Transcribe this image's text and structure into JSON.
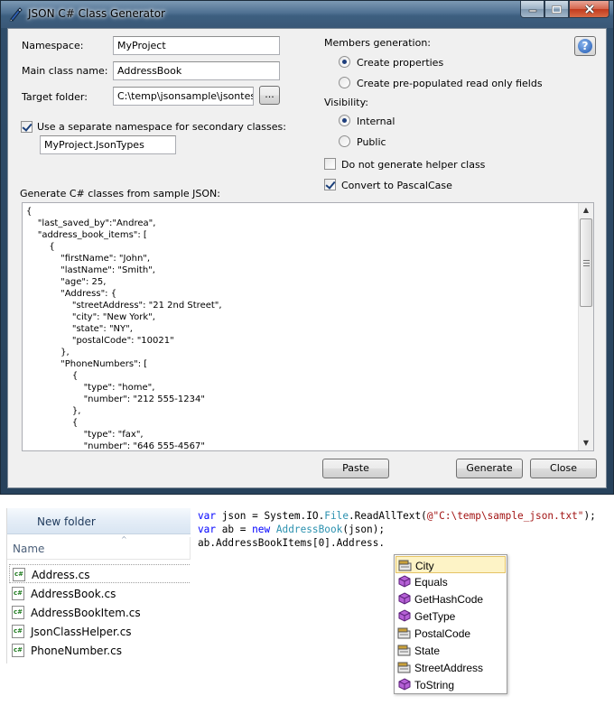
{
  "window": {
    "title": "JSON C# Class Generator"
  },
  "form": {
    "namespace_label": "Namespace:",
    "namespace_value": "MyProject",
    "main_class_label": "Main class name:",
    "main_class_value": "AddressBook",
    "target_folder_label": "Target folder:",
    "target_folder_value": "C:\\temp\\jsonsample\\jsontest\\",
    "browse_label": "...",
    "separate_ns_label": "Use a separate namespace for secondary classes:",
    "separate_ns_checked": true,
    "secondary_ns_value": "MyProject.JsonTypes",
    "sample_json_label": "Generate C# classes from sample JSON:"
  },
  "options": {
    "members_label": "Members generation:",
    "create_properties_label": "Create properties",
    "create_readonly_label": "Create pre-populated read only fields",
    "members_selected": "properties",
    "visibility_label": "Visibility:",
    "internal_label": "Internal",
    "public_label": "Public",
    "visibility_selected": "internal",
    "no_helper_label": "Do not generate helper class",
    "no_helper_checked": false,
    "pascal_label": "Convert to PascalCase",
    "pascal_checked": true
  },
  "json_sample": "{\n    \"last_saved_by\":\"Andrea\",\n    \"address_book_items\": [\n        {\n            \"firstName\": \"John\",\n            \"lastName\": \"Smith\",\n            \"age\": 25,\n            \"Address\": {\n                \"streetAddress\": \"21 2nd Street\",\n                \"city\": \"New York\",\n                \"state\": \"NY\",\n                \"postalCode\": \"10021\"\n            },\n            \"PhoneNumbers\": [\n                {\n                    \"type\": \"home\",\n                    \"number\": \"212 555-1234\"\n                },\n                {\n                    \"type\": \"fax\",\n                    \"number\": \"646 555-4567\"",
  "buttons": {
    "paste": "Paste",
    "generate": "Generate",
    "close": "Close"
  },
  "explorer": {
    "new_folder": "New folder",
    "column_name": "Name",
    "files": [
      "Address.cs",
      "AddressBook.cs",
      "AddressBookItem.cs",
      "JsonClassHelper.cs",
      "PhoneNumber.cs"
    ]
  },
  "code": {
    "line1": {
      "kw": "var",
      "a": " json = System.IO.",
      "type": "File",
      "b": ".ReadAllText(",
      "str": "@\"C:\\temp\\sample_json.txt\"",
      "c": ");"
    },
    "line2": {
      "kw1": "var",
      "a": " ab = ",
      "kw2": "new",
      "b": " ",
      "type": "AddressBook",
      "c": "(json);"
    },
    "line3": "ab.AddressBookItems[0].Address."
  },
  "intellisense": {
    "selected": "City",
    "items": [
      {
        "label": "City",
        "icon": "property-icon"
      },
      {
        "label": "Equals",
        "icon": "method-icon"
      },
      {
        "label": "GetHashCode",
        "icon": "method-icon"
      },
      {
        "label": "GetType",
        "icon": "method-icon"
      },
      {
        "label": "PostalCode",
        "icon": "property-icon"
      },
      {
        "label": "State",
        "icon": "property-icon"
      },
      {
        "label": "StreetAddress",
        "icon": "property-icon"
      },
      {
        "label": "ToString",
        "icon": "method-icon"
      }
    ]
  },
  "colors": {
    "keyword": "#0000ff",
    "type": "#2b91af",
    "string": "#a31515",
    "selection_bg": "#fdf3c6",
    "csharp_icon": "#1d7a1d"
  }
}
